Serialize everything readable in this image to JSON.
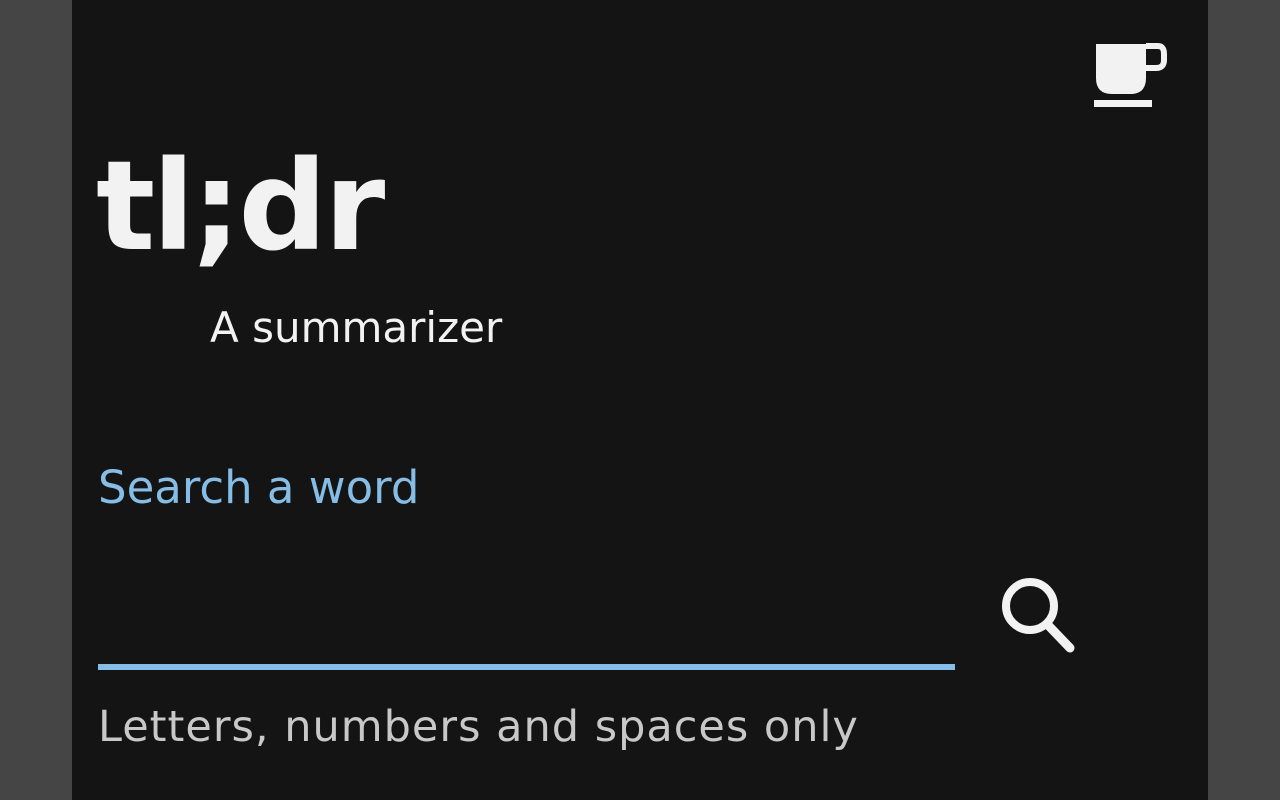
{
  "header": {
    "title": "tl;dr",
    "subtitle": "A summarizer",
    "coffee_icon": "coffee-cup-icon"
  },
  "search": {
    "label": "Search a word",
    "value": "",
    "placeholder": "",
    "helper_text": "Letters, numbers and spaces only",
    "search_icon": "magnifier-icon"
  },
  "colors": {
    "background": "#141414",
    "outer": "#454545",
    "accent": "#86bde6",
    "text": "#f2f2f2",
    "helper": "#c8c8c8"
  }
}
